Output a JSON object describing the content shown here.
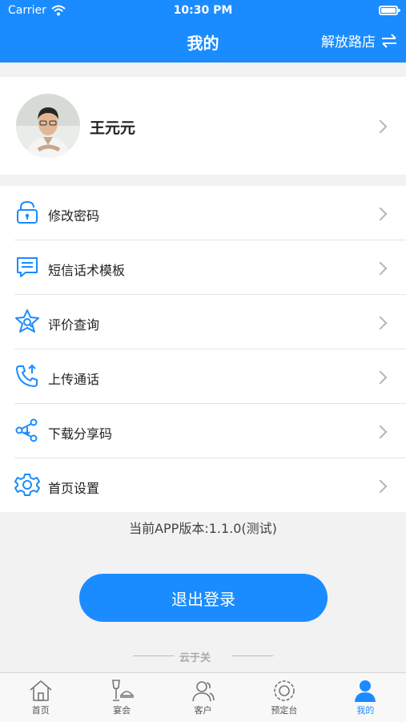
{
  "status_bar": {
    "carrier": "Carrier",
    "time": "10:30 PM"
  },
  "nav": {
    "title": "我的",
    "store": "解放路店"
  },
  "profile": {
    "name": "王元元"
  },
  "menu": [
    {
      "label": "修改密码",
      "icon": "lock-icon"
    },
    {
      "label": "短信话术模板",
      "icon": "message-icon"
    },
    {
      "label": "评价查询",
      "icon": "star-search-icon"
    },
    {
      "label": "上传通话",
      "icon": "phone-upload-icon"
    },
    {
      "label": "下载分享码",
      "icon": "share-download-icon"
    },
    {
      "label": "首页设置",
      "icon": "gear-icon"
    }
  ],
  "version_text": "当前APP版本:1.1.0(测试)",
  "logout_label": "退出登录",
  "brand": "云于关",
  "tabs": [
    {
      "label": "首页",
      "icon": "home-icon",
      "active": false
    },
    {
      "label": "宴会",
      "icon": "banquet-icon",
      "active": false
    },
    {
      "label": "客户",
      "icon": "customers-icon",
      "active": false
    },
    {
      "label": "预定台",
      "icon": "reservation-icon",
      "active": false
    },
    {
      "label": "我的",
      "icon": "profile-icon",
      "active": true
    }
  ],
  "colors": {
    "primary": "#1a8cff",
    "background": "#f2f2f2"
  }
}
